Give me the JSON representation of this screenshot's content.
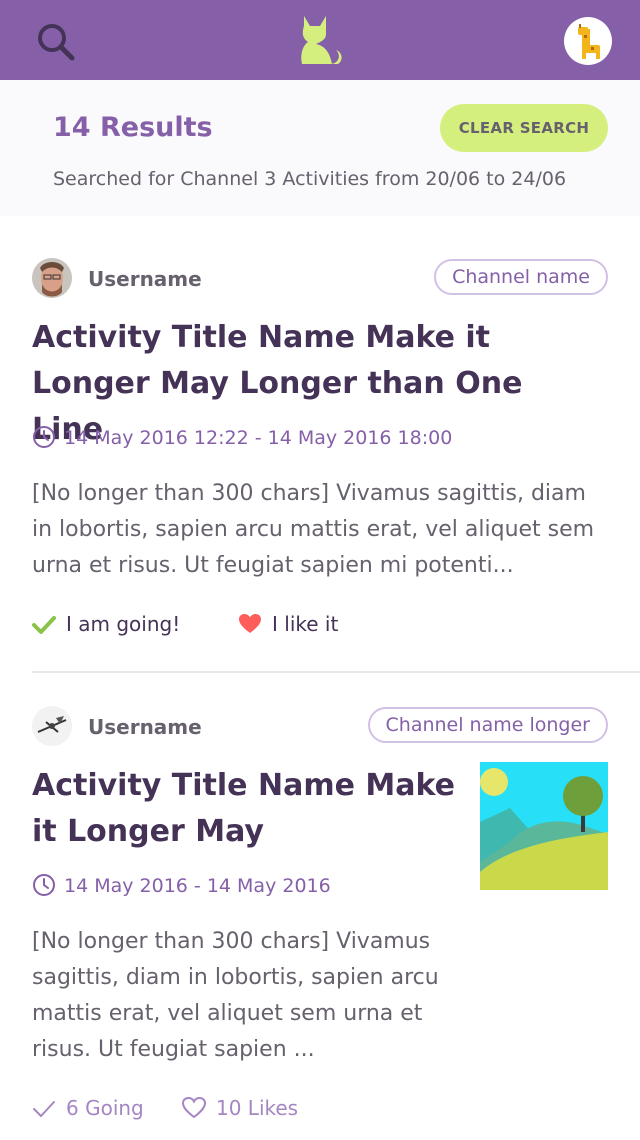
{
  "results": {
    "count": "14 Results",
    "clear_label": "CLEAR SEARCH",
    "description": "Searched for Channel 3 Activities from 20/06 to 24/06"
  },
  "cards": [
    {
      "username": "Username",
      "channel": "Channel name",
      "title": "Activity Title Name Make it Longer May Longer than One Line",
      "time": "14 May 2016 12:22 - 14 May 2016 18:00",
      "body": "[No longer than 300 chars] Vivamus sagittis, diam in lobortis, sapien arcu mattis erat, vel aliquet sem urna et risus. Ut feugiat sapien mi potenti...",
      "going_label": "I am going!",
      "like_label": "I like it"
    },
    {
      "username": "Username",
      "channel": "Channel name longer",
      "title": "Activity Title Name Make it Longer May",
      "time": "14 May 2016 - 14 May 2016",
      "body": "[No longer than 300 chars] Vivamus sagittis, diam in lobortis, sapien arcu mattis erat, vel aliquet sem urna et risus. Ut feugiat sapien ...",
      "going_label": "6 Going",
      "like_label": "10 Likes"
    }
  ],
  "colors": {
    "brand": "#8560A8",
    "accent": "#D5EF7F",
    "title": "#453257",
    "text": "#67616D",
    "going_check": "#8BC34A",
    "heart": "#FF5C5C"
  },
  "icons": {
    "search": "search-icon",
    "logo": "cat-logo-icon",
    "user": "giraffe-avatar-icon",
    "clock": "clock-icon",
    "check": "check-icon",
    "heart": "heart-icon"
  }
}
